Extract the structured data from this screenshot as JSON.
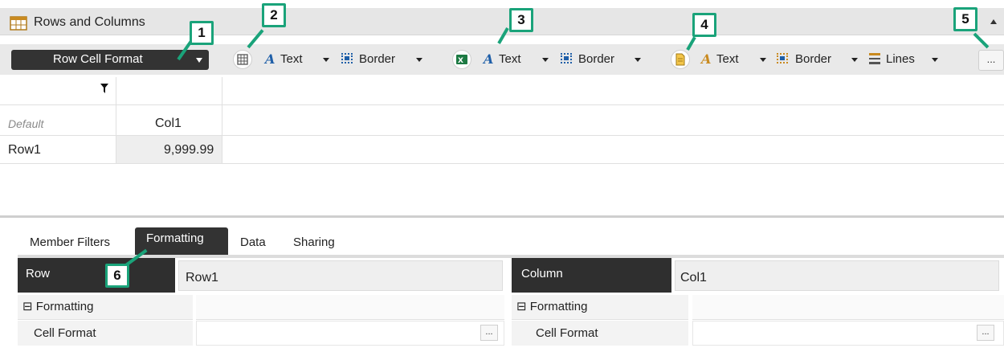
{
  "header": {
    "title": "Rows and Columns"
  },
  "toolbar": {
    "format_selector": "Row Cell Format",
    "groups": [
      {
        "icon": "grid-icon",
        "text": "Text",
        "border": "Border"
      },
      {
        "icon": "excel-icon",
        "text": "Text",
        "border": "Border"
      },
      {
        "icon": "document-icon",
        "text": "Text",
        "border": "Border",
        "lines": "Lines"
      }
    ],
    "more": "..."
  },
  "grid": {
    "header_row": {
      "col1": "Col1",
      "default_label": "Default"
    },
    "rows": [
      {
        "label": "Row1",
        "value": "9,999.99"
      }
    ]
  },
  "tabs": [
    "Member Filters",
    "Formatting",
    "Data",
    "Sharing"
  ],
  "active_tab": "Formatting",
  "row_panel": {
    "label": "Row",
    "value": "Row1",
    "section": "⊟ Formatting",
    "property": "Cell Format",
    "button": "..."
  },
  "column_panel": {
    "label": "Column",
    "value": "Col1",
    "section": "⊟ Formatting",
    "property": "Cell Format",
    "button": "..."
  },
  "callouts": [
    "1",
    "2",
    "3",
    "4",
    "5",
    "6"
  ],
  "colors": {
    "accent": "#1aa37a",
    "dark": "#333333",
    "icon_blue": "#1f5fa8"
  }
}
